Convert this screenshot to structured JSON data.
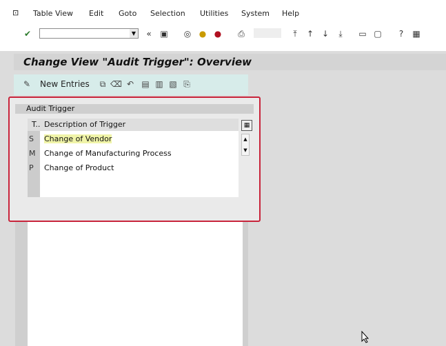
{
  "menu": {
    "system_icon": "⊡",
    "items": [
      "Table View",
      "Edit",
      "Goto",
      "Selection",
      "Utilities",
      "System",
      "Help"
    ]
  },
  "toolbar": {
    "command_field_value": "",
    "icons": [
      "check-icon",
      "command-dropdown-icon",
      "back-icon",
      "save-icon",
      "exit-icon",
      "cancel-icon",
      "print-icon",
      "find-icon",
      "find-next-icon",
      "first-page-icon",
      "prev-page-icon",
      "next-page-icon",
      "last-page-icon",
      "new-session-icon",
      "shortcut-icon",
      "customize-icon",
      "help-icon"
    ]
  },
  "title": "Change View \"Audit Trigger\": Overview",
  "app_toolbar": {
    "new_entries": "New Entries"
  },
  "group_title": "Audit Trigger",
  "table": {
    "columns": [
      "T..",
      "Description of Trigger"
    ],
    "rows": [
      {
        "key": "S",
        "desc": "Change of Vendor",
        "selected": true
      },
      {
        "key": "M",
        "desc": "Change of Manufacturing Process",
        "selected": false
      },
      {
        "key": "P",
        "desc": "Change of Product",
        "selected": false
      }
    ]
  },
  "colors": {
    "highlight_border": "#c8233a",
    "selected_row": "#f0f4a8",
    "app_toolbar_bg": "#d7ecea"
  }
}
